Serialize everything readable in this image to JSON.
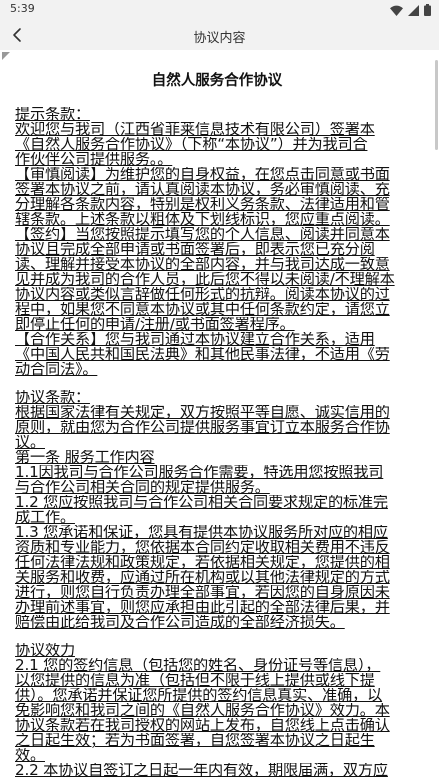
{
  "status": {
    "time": "5:39"
  },
  "navbar": {
    "title": "协议内容"
  },
  "document": {
    "title": "自然人服务合作协议",
    "paragraphs": [
      {
        "id": "p1",
        "lines": [
          "提示条款：",
          "欢迎您与我司（江西省菲莱信息技术有限公司）签署本",
          "《自然人服务合作协议》（下称“本协议”）并为我司合",
          "作伙伴公司提供服务。。"
        ]
      },
      {
        "id": "p2",
        "lines": [
          "【审慎阅读】为维护您的自身权益，在您点击同意或书面",
          "签署本协议之前，请认真阅读本协议，务必审慎阅读、充",
          "分理解各条款内容，特别是权利义务条款、法律适用和管",
          "辖条款。上述条款以粗体及下划线标识，您应重点阅读。"
        ]
      },
      {
        "id": "p3",
        "lines": [
          "【签约】当您按照提示填写您的个人信息、阅读并同意本",
          "协议且完成全部申请或书面签署后，即表示您已充分阅",
          "读、理解并接受本协议的全部内容，并与我司达成一致意",
          "见并成为我司的合作人员，此后您不得以未阅读/不理解本",
          "协议内容或类似言辞做任何形式的抗辩。阅读本协议的过",
          "程中，如果您不同意本协议或其中任何条款约定，请您立",
          "即停止任何的申请/注册/或书面签署程序。"
        ]
      },
      {
        "id": "p4",
        "lines": [
          "【合作关系】您与我司通过本协议建立合作关系，适用",
          "《中国人民共和国民法典》和其他民事法律，不适用《劳",
          "动合同法》。"
        ]
      },
      {
        "id": "p5",
        "lines": [
          "协议条款：",
          "根据国家法律有关规定，双方按照平等自愿、诚实信用的",
          "原则，就由您为合作公司提供服务事宜订立本服务合作协",
          "议。"
        ]
      },
      {
        "id": "p6",
        "lines": [
          "第一条 服务工作内容",
          "1.1因我司与合作公司服务合作需要，特选用您按照我司",
          "与合作公司相关合同的规定提供服务。",
          "1.2 您应按照我司与合作公司相关合同要求规定的标准完",
          "成工作。",
          "1.3 您承诺和保证，您具有提供本协议服务所对应的相应",
          "资质和专业能力，您依据本合同约定收取相关费用不违反",
          "任何法律法规和政策规定，若依据相关规定，您提供的相",
          "关服务和收费，应通过所在机构或以其他法律规定的方式",
          "进行，则您自行负责办理全部事宜，若因您的自身原因未",
          "办理前述事宜，则您应承担由此引起的全部法律后果，并",
          "赔偿由此给我司及合作公司造成的全部经济损失。"
        ]
      },
      {
        "id": "p7",
        "lines": [
          "协议效力",
          "2.1 您的签约信息（包括您的姓名、身份证号等信息），",
          "以您提供的信息为准（包括但不限于线上提供或线下提",
          "供）。您承诺并保证您所提供的签约信息真实、准确，以",
          "免影响您和我司之间的《自然人服务合作协议》效力。本",
          "协议条款若在我司授权的网站上发布，自您线上点击确认",
          "之日起生效；若为书面签署，自您签署本协议之日起生",
          "效。",
          "2.2 本协议自签订之日起一年内有效，期限届满，双方应"
        ]
      }
    ]
  }
}
